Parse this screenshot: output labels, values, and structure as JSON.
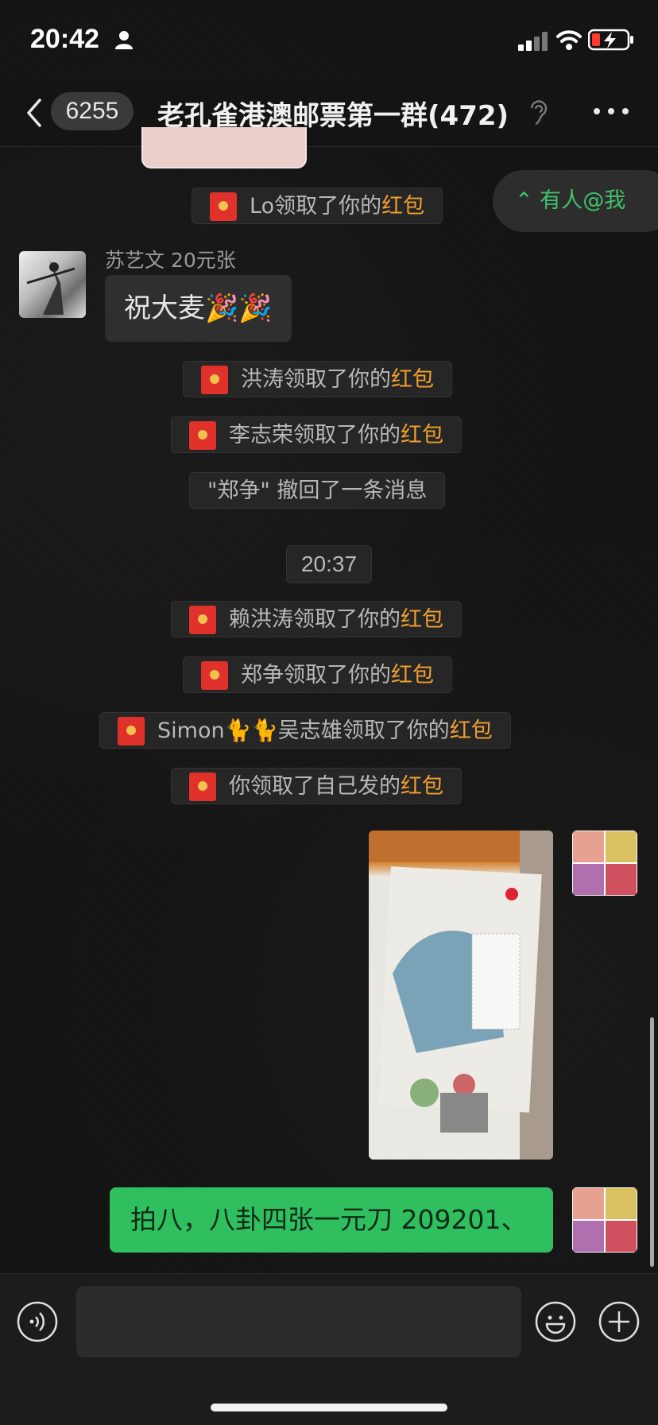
{
  "status_bar": {
    "time": "20:42"
  },
  "header": {
    "unread_count": "6255",
    "title": "老孔雀港澳邮票第一群(472)"
  },
  "mention_button": {
    "label": "⌃ 有人@我"
  },
  "messages": {
    "rp1": {
      "prefix": "Lo领取了你的",
      "hl": "红包"
    },
    "sender_name": "苏艺文 20元张",
    "bubble_text": "祝大麦🎉🎉",
    "rp2": {
      "prefix": "洪涛领取了你的",
      "hl": "红包"
    },
    "rp3": {
      "prefix": "李志荣领取了你的",
      "hl": "红包"
    },
    "recall": "\"郑争\" 撤回了一条消息",
    "time": "20:37",
    "rp4": {
      "prefix": "赖洪涛领取了你的",
      "hl": "红包"
    },
    "rp5": {
      "prefix": "郑争领取了你的",
      "hl": "红包"
    },
    "rp6": {
      "prefix": "Simon🐈🐈吴志雄领取了你的",
      "hl": "红包"
    },
    "rp7": {
      "prefix": "你领取了自己发的",
      "hl": "红包"
    },
    "self_text": "拍八，八卦四张一元刀 209201、"
  },
  "input": {
    "placeholder": ""
  },
  "colors": {
    "background": "#141414",
    "highlight": "#f0a02e",
    "self_bubble": "#2fbf5f",
    "mention": "#3fc36b"
  },
  "icons": [
    "person-icon",
    "signal-icon",
    "wifi-icon",
    "battery-icon",
    "back-icon",
    "ear-icon",
    "more-icon",
    "red-packet-icon",
    "voice-icon",
    "emoji-icon",
    "plus-icon"
  ]
}
